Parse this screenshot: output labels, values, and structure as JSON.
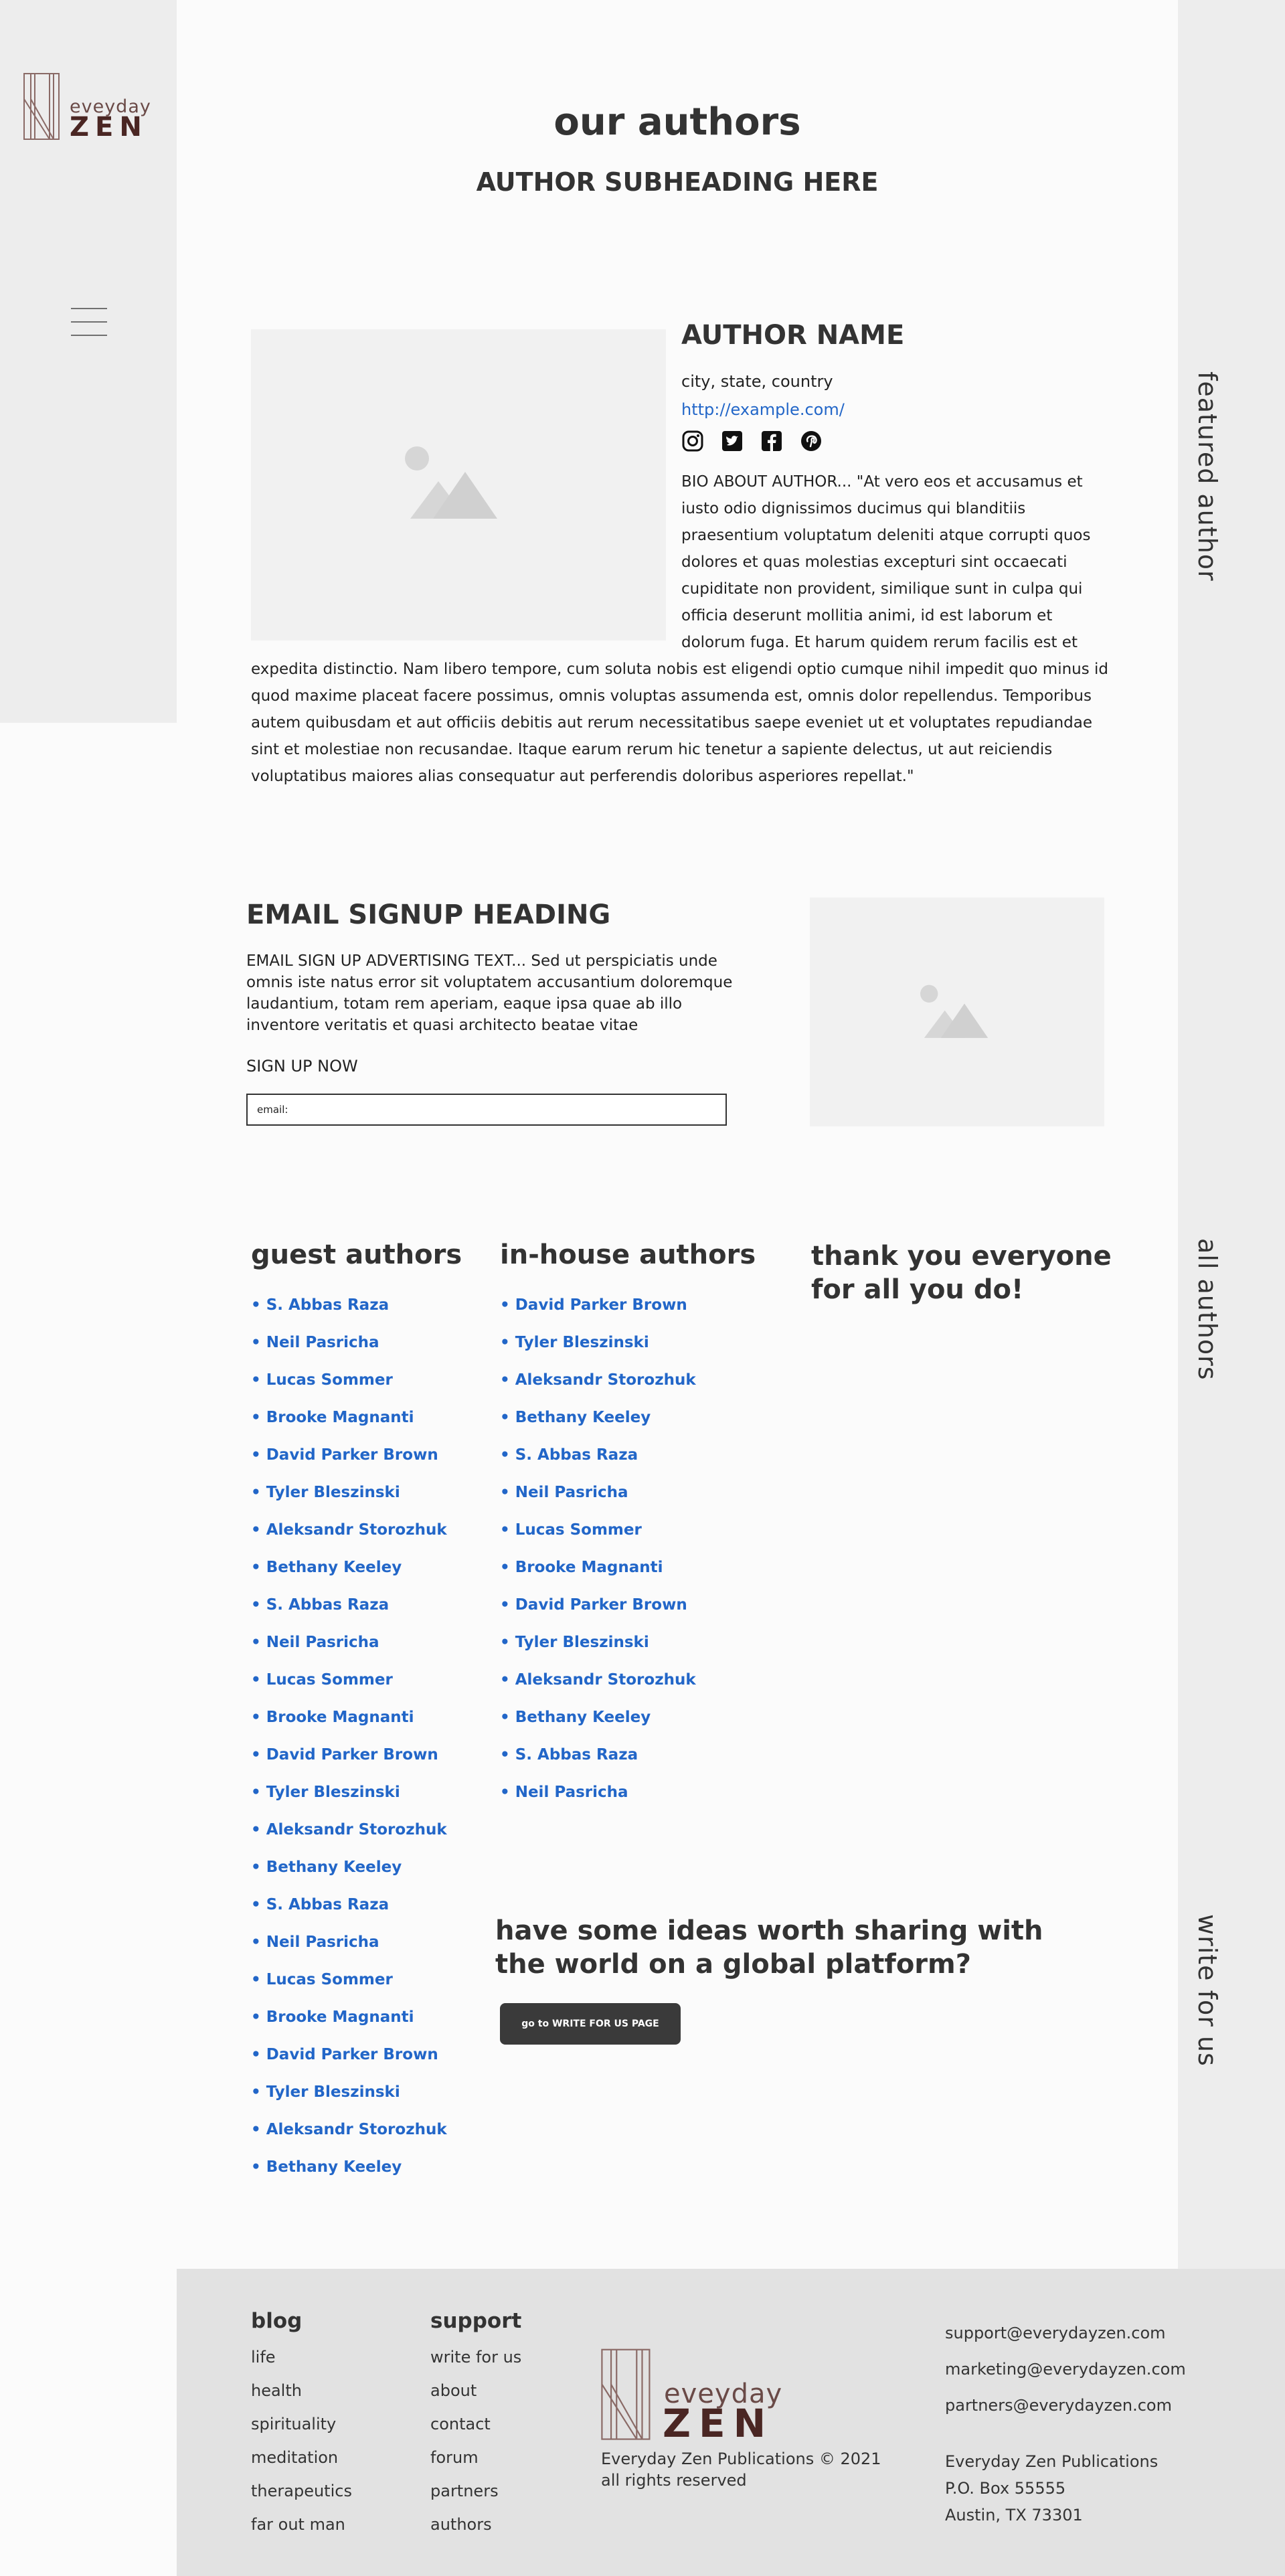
{
  "brand": {
    "word1": "eveyday",
    "word2": "ZEN"
  },
  "header": {
    "title": "our authors",
    "subtitle": "AUTHOR SUBHEADING HERE"
  },
  "side_labels": {
    "featured": "featured author",
    "all": "all authors",
    "write": "write for us"
  },
  "featured_author": {
    "name": "AUTHOR NAME",
    "location": "city, state, country",
    "url": "http://example.com/",
    "bio_part1": "BIO ABOUT AUTHOR... \"At vero eos et accusamus et iusto odio dignissimos ducimus qui blanditiis praesentium voluptatum deleniti atque corrupti quos dolores et quas molestias excepturi sint occaecati cupiditate non provident, similique sunt in culpa qui officia deserunt mollitia animi, id est laborum et dolorum fuga. Et harum quidem rerum facilis est et",
    "bio_part2": "expedita distinctio. Nam libero tempore, cum soluta nobis est eligendi optio cumque nihil impedit quo minus id quod maxime placeat facere possimus, omnis voluptas assumenda est, omnis dolor repellendus. Temporibus autem quibusdam et aut officiis debitis aut rerum necessitatibus saepe eveniet ut et voluptates repudiandae sint et molestiae non recusandae. Itaque earum rerum hic tenetur a sapiente delectus, ut aut reiciendis voluptatibus maiores alias consequatur aut perferendis doloribus asperiores repellat.\"",
    "socials": [
      "instagram-icon",
      "twitter-icon",
      "facebook-icon",
      "pinterest-icon"
    ]
  },
  "signup": {
    "heading": "EMAIL SIGNUP HEADING",
    "text": "EMAIL SIGN UP ADVERTISING TEXT... Sed ut perspiciatis unde omnis iste natus error sit voluptatem accusantium doloremque laudantium, totam rem aperiam, eaque ipsa quae ab illo inventore veritatis et quasi architecto beatae vitae",
    "cta": "SIGN UP NOW",
    "placeholder": "email:"
  },
  "guest_authors": {
    "heading": "guest authors",
    "items": [
      "• S. Abbas Raza",
      "• Neil Pasricha",
      "• Lucas Sommer",
      "• Brooke Magnanti",
      "• David Parker Brown",
      "• Tyler Bleszinski",
      "• Aleksandr Storozhuk",
      "• Bethany Keeley",
      "• S. Abbas Raza",
      "• Neil Pasricha",
      "• Lucas Sommer",
      "• Brooke Magnanti",
      "• David Parker Brown",
      "• Tyler Bleszinski",
      "• Aleksandr Storozhuk",
      "• Bethany Keeley",
      "• S. Abbas Raza",
      "• Neil Pasricha",
      "• Lucas Sommer",
      "• Brooke Magnanti",
      "• David Parker Brown",
      "• Tyler Bleszinski",
      "• Aleksandr Storozhuk",
      "• Bethany Keeley"
    ]
  },
  "inhouse_authors": {
    "heading": "in-house authors",
    "items": [
      "• David Parker Brown",
      "• Tyler Bleszinski",
      "• Aleksandr Storozhuk",
      "• Bethany Keeley",
      "• S. Abbas Raza",
      "• Neil Pasricha",
      "• Lucas Sommer",
      "• Brooke Magnanti",
      "• David Parker Brown",
      "• Tyler Bleszinski",
      "• Aleksandr Storozhuk",
      "• Bethany Keeley",
      "• S. Abbas Raza",
      "• Neil Pasricha"
    ]
  },
  "thanks": "thank you everyone for all you do!",
  "write_for_us": {
    "heading": "have some ideas worth sharing with the world on a global platform?",
    "button": "go to WRITE FOR US PAGE"
  },
  "footer": {
    "blog": {
      "heading": "blog",
      "links": [
        "life",
        "health",
        "spirituality",
        "meditation",
        "therapeutics",
        "far out man"
      ]
    },
    "support": {
      "heading": "support",
      "links": [
        "write for us",
        "about",
        "contact",
        "forum",
        "partners",
        "authors"
      ]
    },
    "copyright": "Everyday Zen Publications © 2021",
    "rights": "all rights reserved",
    "emails": [
      "support@everydayzen.com",
      "marketing@everydayzen.com",
      "partners@everydayzen.com"
    ],
    "address": [
      "Everyday Zen Publications",
      "P.O. Box 55555",
      "Austin, TX 73301"
    ]
  },
  "colors": {
    "link": "#2266c8",
    "rail": "#ededed",
    "footer": "#e2e2e2",
    "button": "#3a3a3a",
    "brand": "#4a2623"
  }
}
